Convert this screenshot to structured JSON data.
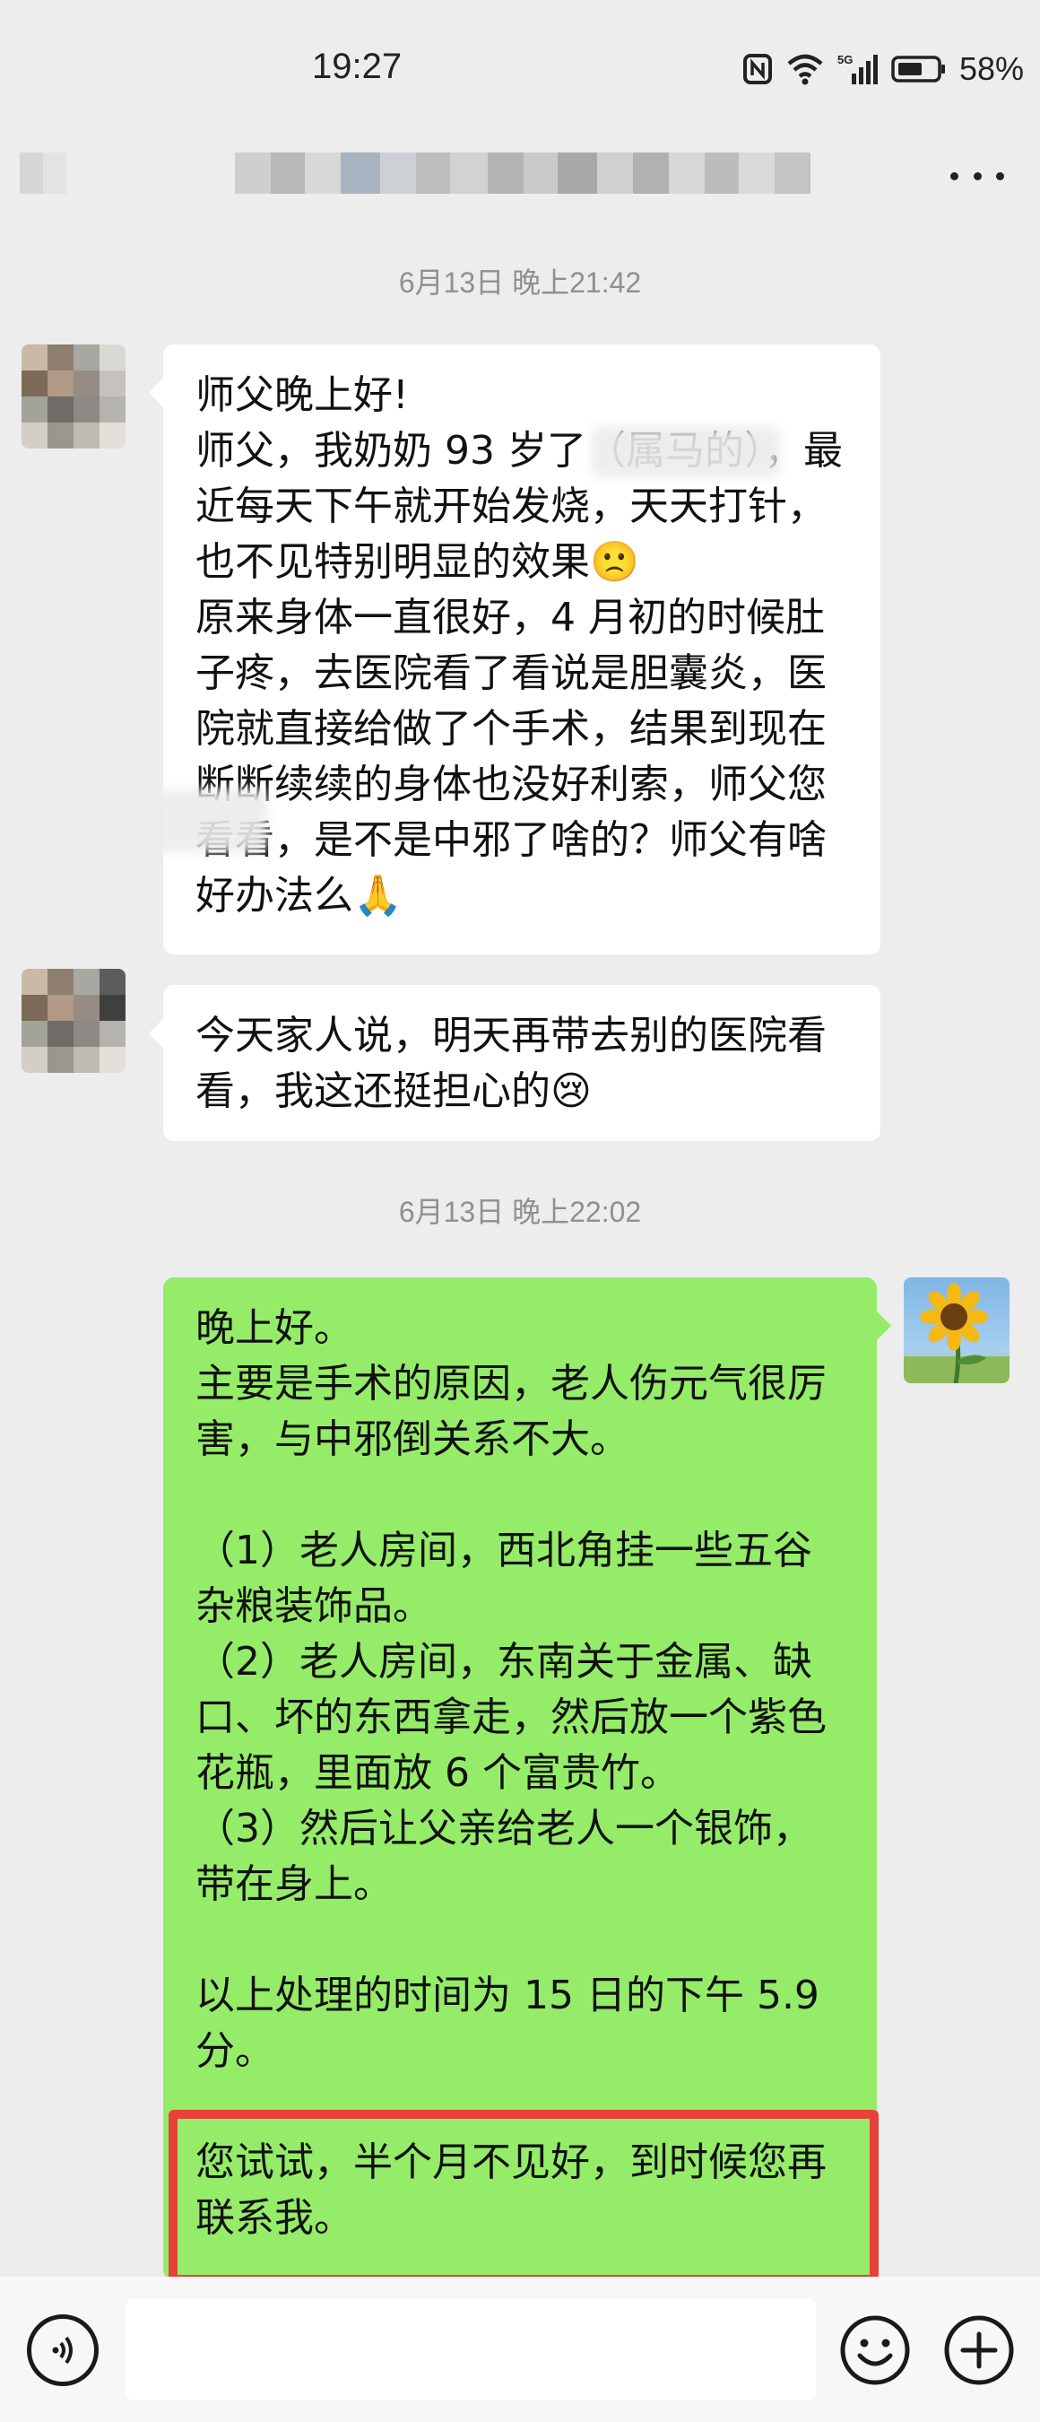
{
  "status_bar": {
    "time": "19:27",
    "battery_percent": "58%",
    "network": "5G"
  },
  "chat": {
    "more_icon": "more-horizontal-icon",
    "messages": [
      {
        "type": "timestamp",
        "text": "6月13日 晚上21:42"
      },
      {
        "type": "incoming",
        "text": "师父晚上好!\n师父，我奶奶 93 岁了（属马的），最近每天下午就开始发烧，天天打针，也不见特别明显的效果🙁\n原来身体一直很好，4 月初的时候肚子疼，去医院看了看说是胆囊炎，医院就直接给做了个手术，结果到现在断断续续的身体也没好利索，师父您看看，是不是中邪了啥的？师父有啥好办法么🙏"
      },
      {
        "type": "incoming",
        "text": "今天家人说，明天再带去别的医院看看，我这还挺担心的😢"
      },
      {
        "type": "timestamp",
        "text": "6月13日 晚上22:02"
      },
      {
        "type": "outgoing",
        "text": "晚上好。\n主要是手术的原因，老人伤元气很厉害，与中邪倒关系不大。\n\n（1）老人房间，西北角挂一些五谷杂粮装饰品。\n（2）老人房间，东南关于金属、缺口、坏的东西拿走，然后放一个紫色花瓶，里面放 6 个富贵竹。\n（3）然后让父亲给老人一个银饰，带在身上。\n\n以上处理的时间为 15 日的下午 5.9 分。\n\n您试试，半个月不见好，到时候您再联系我。"
      }
    ]
  },
  "input_bar": {
    "voice_icon": "voice-icon",
    "emoji_icon": "emoji-icon",
    "plus_icon": "plus-icon",
    "placeholder": ""
  },
  "colors": {
    "incoming_bubble": "#ffffff",
    "outgoing_bubble": "#95ec69",
    "highlight": "#e8403a",
    "background": "#ededed"
  }
}
